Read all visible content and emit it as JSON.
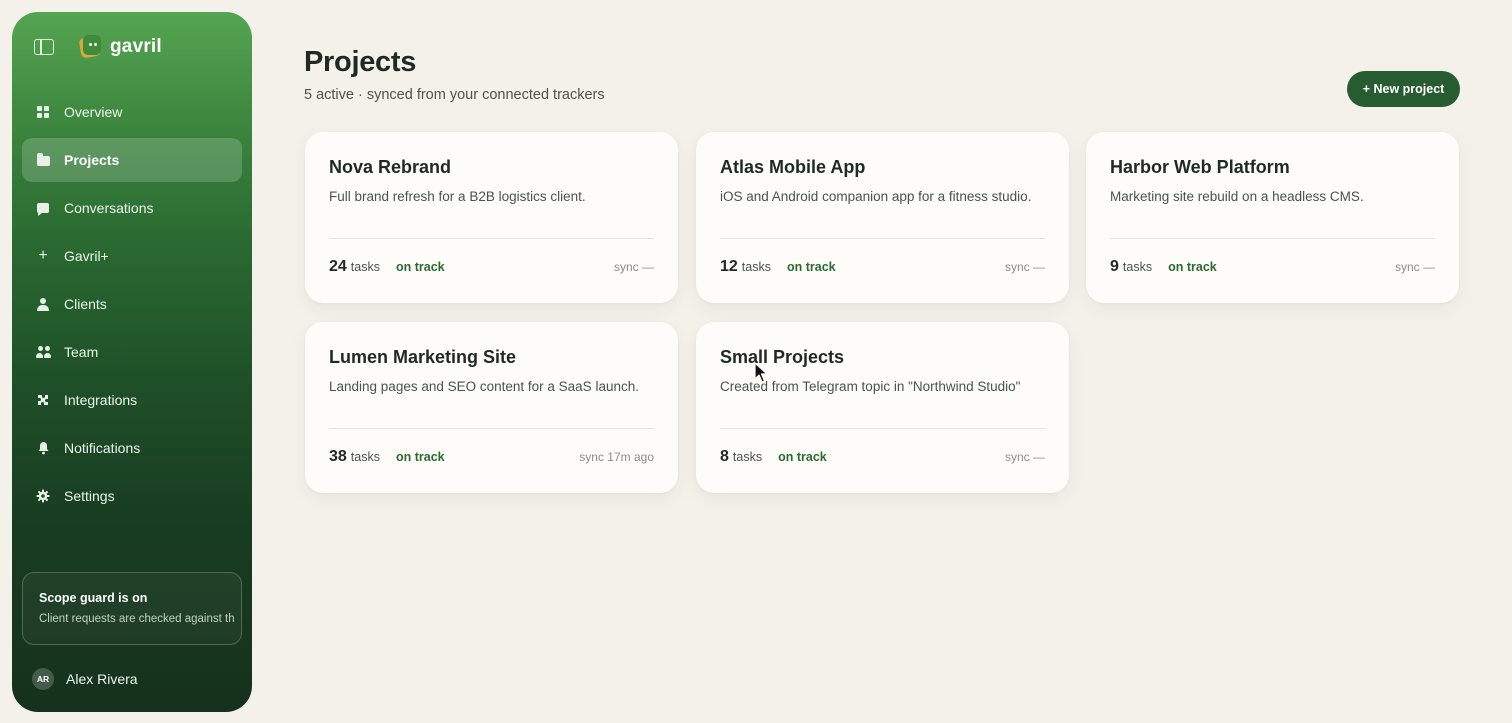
{
  "app": {
    "brand_name": "gavril"
  },
  "sidebar": {
    "items": [
      {
        "label": "Overview",
        "icon": "grid-icon",
        "active": false
      },
      {
        "label": "Projects",
        "icon": "folder-icon",
        "active": true
      },
      {
        "label": "Conversations",
        "icon": "chat-icon",
        "active": false
      },
      {
        "label": "Gavril+",
        "icon": "plus-icon",
        "active": false
      },
      {
        "label": "Clients",
        "icon": "user-icon",
        "active": false
      },
      {
        "label": "Team",
        "icon": "team-icon",
        "active": false
      },
      {
        "label": "Integrations",
        "icon": "puzzle-icon",
        "active": false
      },
      {
        "label": "Notifications",
        "icon": "bell-icon",
        "active": false
      },
      {
        "label": "Settings",
        "icon": "gear-icon",
        "active": false
      }
    ],
    "scope_guard": {
      "title": "Scope guard is on",
      "text": "Client requests are checked against th"
    },
    "user": {
      "initials": "AR",
      "name": "Alex Rivera"
    }
  },
  "main": {
    "title": "Projects",
    "subtitle": "5 active · synced from your connected trackers",
    "new_button_label": "+ New project",
    "projects": [
      {
        "title": "Nova Rebrand",
        "description": "Full brand refresh for a B2B logistics client.",
        "task_count": "24",
        "task_label": "tasks",
        "status": "on track",
        "sync": "sync —"
      },
      {
        "title": "Atlas Mobile App",
        "description": "iOS and Android companion app for a fitness studio.",
        "task_count": "12",
        "task_label": "tasks",
        "status": "on track",
        "sync": "sync —"
      },
      {
        "title": "Harbor Web Platform",
        "description": "Marketing site rebuild on a headless CMS.",
        "task_count": "9",
        "task_label": "tasks",
        "status": "on track",
        "sync": "sync —"
      },
      {
        "title": "Lumen Marketing Site",
        "description": "Landing pages and SEO content for a SaaS launch.",
        "task_count": "38",
        "task_label": "tasks",
        "status": "on track",
        "sync": "sync 17m ago"
      },
      {
        "title": "Small Projects",
        "description": "Created from Telegram topic in \"Northwind Studio\"",
        "task_count": "8",
        "task_label": "tasks",
        "status": "on track",
        "sync": "sync —"
      }
    ]
  },
  "colors": {
    "background": "#f4f1ea",
    "sidebar_top": "#55a552",
    "sidebar_bottom": "#16311d",
    "accent": "#275c31",
    "status_green": "#2b6b32"
  }
}
